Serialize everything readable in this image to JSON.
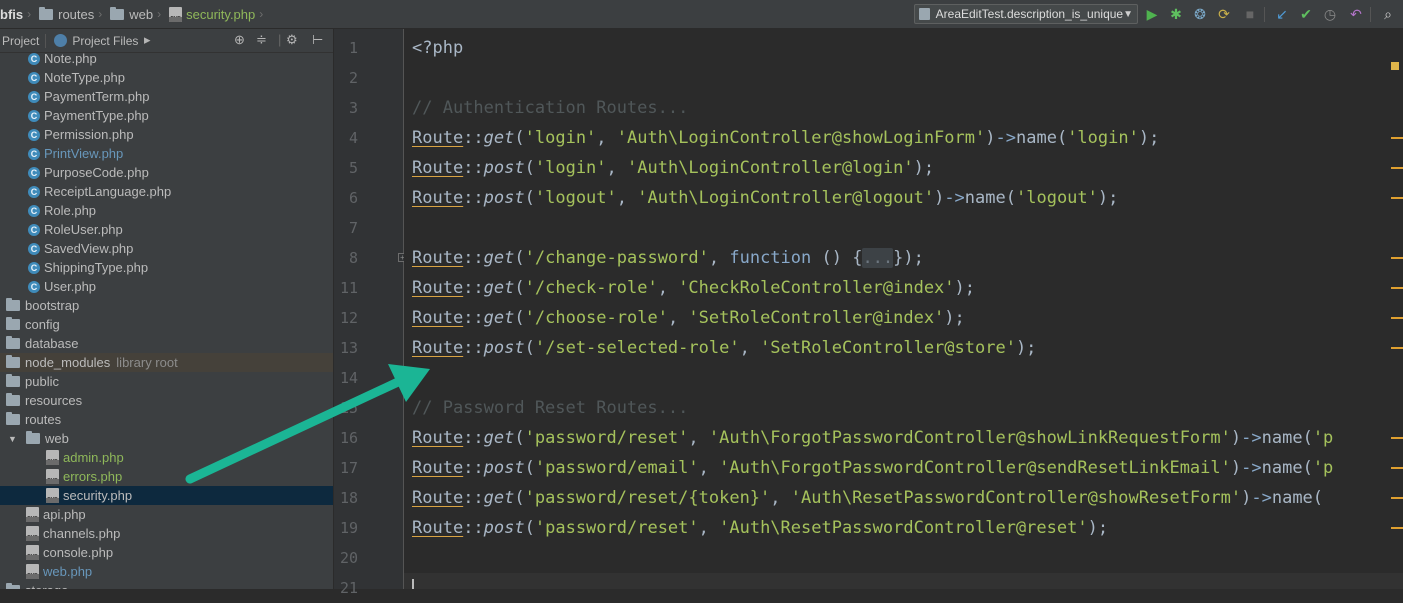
{
  "navbar": {
    "breadcrumbs": [
      {
        "name": "bfis",
        "kind": "project"
      },
      {
        "name": "routes",
        "kind": "folder"
      },
      {
        "name": "web",
        "kind": "folder"
      },
      {
        "name": "security.php",
        "kind": "file"
      }
    ],
    "run_config": "AreaEditTest.description_is_unique",
    "toolbar_icons": [
      "run-icon",
      "debug-icon",
      "coverage-icon",
      "profile-icon",
      "stop-icon",
      "vcs-update-icon",
      "vcs-commit-icon",
      "vcs-history-icon",
      "revert-icon",
      "search-icon"
    ]
  },
  "project_bar": {
    "view_label": "Project",
    "files_label": "Project Files"
  },
  "tree": {
    "items": [
      {
        "label": "Note.php",
        "type": "class",
        "color": "normal"
      },
      {
        "label": "NoteType.php",
        "type": "class",
        "color": "normal"
      },
      {
        "label": "PaymentTerm.php",
        "type": "class",
        "color": "normal"
      },
      {
        "label": "PaymentType.php",
        "type": "class",
        "color": "normal"
      },
      {
        "label": "Permission.php",
        "type": "class",
        "color": "normal"
      },
      {
        "label": "PrintView.php",
        "type": "class",
        "color": "blue"
      },
      {
        "label": "PurposeCode.php",
        "type": "class",
        "color": "normal"
      },
      {
        "label": "ReceiptLanguage.php",
        "type": "class",
        "color": "normal"
      },
      {
        "label": "Role.php",
        "type": "class",
        "color": "normal"
      },
      {
        "label": "RoleUser.php",
        "type": "class",
        "color": "normal"
      },
      {
        "label": "SavedView.php",
        "type": "class",
        "color": "normal"
      },
      {
        "label": "ShippingType.php",
        "type": "class",
        "color": "normal"
      },
      {
        "label": "User.php",
        "type": "class",
        "color": "normal"
      },
      {
        "label": "bootstrap",
        "type": "folder",
        "color": "normal"
      },
      {
        "label": "config",
        "type": "folder",
        "color": "normal"
      },
      {
        "label": "database",
        "type": "folder",
        "color": "normal"
      },
      {
        "label": "node_modules",
        "type": "folder",
        "color": "normal",
        "suffix": "library root"
      },
      {
        "label": "public",
        "type": "folder",
        "color": "normal"
      },
      {
        "label": "resources",
        "type": "folder",
        "color": "normal"
      },
      {
        "label": "routes",
        "type": "folder",
        "color": "normal"
      },
      {
        "label": "web",
        "type": "folder-open",
        "color": "normal"
      },
      {
        "label": "admin.php",
        "type": "php",
        "color": "green"
      },
      {
        "label": "errors.php",
        "type": "php",
        "color": "green"
      },
      {
        "label": "security.php",
        "type": "php",
        "color": "normal",
        "selected": true
      },
      {
        "label": "api.php",
        "type": "php",
        "color": "normal"
      },
      {
        "label": "channels.php",
        "type": "php",
        "color": "normal"
      },
      {
        "label": "console.php",
        "type": "php",
        "color": "normal"
      },
      {
        "label": "web.php",
        "type": "php",
        "color": "blue"
      },
      {
        "label": "storage",
        "type": "folder",
        "color": "normal"
      }
    ]
  },
  "editor": {
    "lines": [
      {
        "num": "1",
        "tokens": [
          [
            "tag",
            "<?php"
          ]
        ]
      },
      {
        "num": "2",
        "tokens": []
      },
      {
        "num": "3",
        "tokens": [
          [
            "comment",
            "// Authentication Routes..."
          ]
        ]
      },
      {
        "num": "4",
        "tokens": [
          [
            "route",
            "Route"
          ],
          [
            "op",
            "::"
          ],
          [
            "fn",
            "get"
          ],
          [
            "pun",
            "("
          ],
          [
            "str",
            "'login'"
          ],
          [
            "pun",
            ", "
          ],
          [
            "str",
            "'Auth\\LoginController@showLoginForm'"
          ],
          [
            "pun",
            ")"
          ],
          [
            "arrow",
            "->"
          ],
          [
            "name",
            "name"
          ],
          [
            "pun",
            "("
          ],
          [
            "str",
            "'login'"
          ],
          [
            "pun",
            ");"
          ]
        ]
      },
      {
        "num": "5",
        "tokens": [
          [
            "route",
            "Route"
          ],
          [
            "op",
            "::"
          ],
          [
            "fn",
            "post"
          ],
          [
            "pun",
            "("
          ],
          [
            "str",
            "'login'"
          ],
          [
            "pun",
            ", "
          ],
          [
            "str",
            "'Auth\\LoginController@login'"
          ],
          [
            "pun",
            ");"
          ]
        ]
      },
      {
        "num": "6",
        "tokens": [
          [
            "route",
            "Route"
          ],
          [
            "op",
            "::"
          ],
          [
            "fn",
            "post"
          ],
          [
            "pun",
            "("
          ],
          [
            "str",
            "'logout'"
          ],
          [
            "pun",
            ", "
          ],
          [
            "str",
            "'Auth\\LoginController@logout'"
          ],
          [
            "pun",
            ")"
          ],
          [
            "arrow",
            "->"
          ],
          [
            "name",
            "name"
          ],
          [
            "pun",
            "("
          ],
          [
            "str",
            "'logout'"
          ],
          [
            "pun",
            ");"
          ]
        ]
      },
      {
        "num": "7",
        "tokens": []
      },
      {
        "num": "8",
        "tokens": [
          [
            "route",
            "Route"
          ],
          [
            "op",
            "::"
          ],
          [
            "fn",
            "get"
          ],
          [
            "pun",
            "("
          ],
          [
            "str",
            "'/change-password'"
          ],
          [
            "pun",
            ", "
          ],
          [
            "kw",
            "function"
          ],
          [
            "pun",
            " () {"
          ],
          [
            "fold",
            "..."
          ],
          [
            "pun",
            "});"
          ]
        ],
        "fold": true
      },
      {
        "num": "11",
        "tokens": [
          [
            "route",
            "Route"
          ],
          [
            "op",
            "::"
          ],
          [
            "fn",
            "get"
          ],
          [
            "pun",
            "("
          ],
          [
            "str",
            "'/check-role'"
          ],
          [
            "pun",
            ", "
          ],
          [
            "str",
            "'CheckRoleController@index'"
          ],
          [
            "pun",
            ");"
          ]
        ]
      },
      {
        "num": "12",
        "tokens": [
          [
            "route",
            "Route"
          ],
          [
            "op",
            "::"
          ],
          [
            "fn",
            "get"
          ],
          [
            "pun",
            "("
          ],
          [
            "str",
            "'/choose-role'"
          ],
          [
            "pun",
            ", "
          ],
          [
            "str",
            "'SetRoleController@index'"
          ],
          [
            "pun",
            ");"
          ]
        ]
      },
      {
        "num": "13",
        "tokens": [
          [
            "route",
            "Route"
          ],
          [
            "op",
            "::"
          ],
          [
            "fn",
            "post"
          ],
          [
            "pun",
            "("
          ],
          [
            "str",
            "'/set-selected-role'"
          ],
          [
            "pun",
            ", "
          ],
          [
            "str",
            "'SetRoleController@store'"
          ],
          [
            "pun",
            ");"
          ]
        ]
      },
      {
        "num": "14",
        "tokens": []
      },
      {
        "num": "15",
        "tokens": [
          [
            "comment",
            "// Password Reset Routes..."
          ]
        ]
      },
      {
        "num": "16",
        "tokens": [
          [
            "route",
            "Route"
          ],
          [
            "op",
            "::"
          ],
          [
            "fn",
            "get"
          ],
          [
            "pun",
            "("
          ],
          [
            "str",
            "'password/reset'"
          ],
          [
            "pun",
            ", "
          ],
          [
            "str",
            "'Auth\\ForgotPasswordController@showLinkRequestForm'"
          ],
          [
            "pun",
            ")"
          ],
          [
            "arrow",
            "->"
          ],
          [
            "name",
            "name"
          ],
          [
            "pun",
            "("
          ],
          [
            "str",
            "'p"
          ]
        ]
      },
      {
        "num": "17",
        "tokens": [
          [
            "route",
            "Route"
          ],
          [
            "op",
            "::"
          ],
          [
            "fn",
            "post"
          ],
          [
            "pun",
            "("
          ],
          [
            "str",
            "'password/email'"
          ],
          [
            "pun",
            ", "
          ],
          [
            "str",
            "'Auth\\ForgotPasswordController@sendResetLinkEmail'"
          ],
          [
            "pun",
            ")"
          ],
          [
            "arrow",
            "->"
          ],
          [
            "name",
            "name"
          ],
          [
            "pun",
            "("
          ],
          [
            "str",
            "'p"
          ]
        ]
      },
      {
        "num": "18",
        "tokens": [
          [
            "route",
            "Route"
          ],
          [
            "op",
            "::"
          ],
          [
            "fn",
            "get"
          ],
          [
            "pun",
            "("
          ],
          [
            "str",
            "'password/reset/{token}'"
          ],
          [
            "pun",
            ", "
          ],
          [
            "str",
            "'Auth\\ResetPasswordController@showResetForm'"
          ],
          [
            "pun",
            ")"
          ],
          [
            "arrow",
            "->"
          ],
          [
            "name",
            "name"
          ],
          [
            "pun",
            "("
          ]
        ]
      },
      {
        "num": "19",
        "tokens": [
          [
            "route",
            "Route"
          ],
          [
            "op",
            "::"
          ],
          [
            "fn",
            "post"
          ],
          [
            "pun",
            "("
          ],
          [
            "str",
            "'password/reset'"
          ],
          [
            "pun",
            ", "
          ],
          [
            "str",
            "'Auth\\ResetPasswordController@reset'"
          ],
          [
            "pun",
            ");"
          ]
        ]
      },
      {
        "num": "20",
        "tokens": []
      },
      {
        "num": "21",
        "tokens": [],
        "current": true
      }
    ]
  },
  "overlay": {
    "arrow_color": "#1bb595"
  }
}
